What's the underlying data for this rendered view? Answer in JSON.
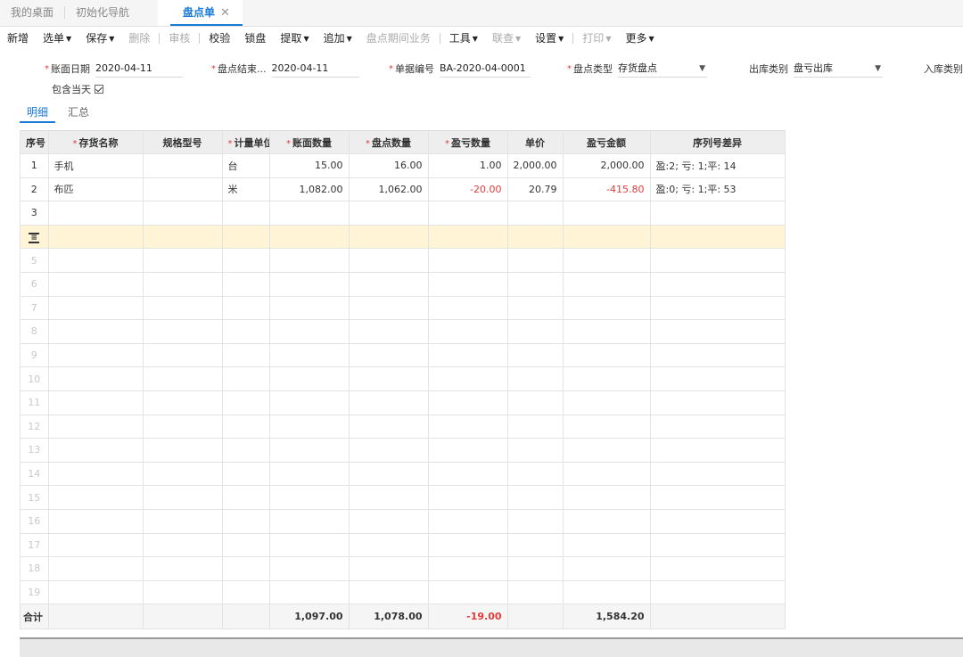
{
  "tabs": [
    {
      "label": "我的桌面",
      "active": false
    },
    {
      "label": "初始化导航",
      "active": false
    },
    {
      "label": "盘点单",
      "active": true
    }
  ],
  "tab_close": "✕",
  "toolbar": {
    "new": "新增",
    "select": "选单",
    "save": "保存",
    "delete": "删除",
    "audit": "审核",
    "verify": "校验",
    "lock": "锁盘",
    "extract": "提取",
    "append": "追加",
    "period_business": "盘点期间业务",
    "tools": "工具",
    "query": "联查",
    "settings": "设置",
    "print": "打印",
    "more": "更多"
  },
  "form": {
    "book_date": {
      "label": "账面日期",
      "value": "2020-04-11"
    },
    "end_date": {
      "label": "盘点结束...",
      "value": "2020-04-11"
    },
    "doc_no": {
      "label": "单据编号",
      "value": "BA-2020-04-0001"
    },
    "count_type": {
      "label": "盘点类型",
      "value": "存货盘点"
    },
    "out_type": {
      "label": "出库类别",
      "value": "盘亏出库"
    },
    "in_type": {
      "label": "入库类别"
    },
    "include_today": {
      "label": "包含当天",
      "checked": true
    }
  },
  "subtabs": [
    {
      "label": "明细",
      "active": true
    },
    {
      "label": "汇总",
      "active": false
    }
  ],
  "columns": [
    "序号",
    "存货名称",
    "规格型号",
    "计量单位",
    "账面数量",
    "盘点数量",
    "盈亏数量",
    "单价",
    "盈亏金额",
    "序列号差异"
  ],
  "required_columns": [
    1,
    3,
    4,
    5,
    6
  ],
  "rows": [
    {
      "idx": "1",
      "name": "手机",
      "spec": "",
      "unit": "台",
      "book_qty": "15.00",
      "count_qty": "16.00",
      "diff_qty": "1.00",
      "price": "2,000.00",
      "diff_amount": "2,000.00",
      "serial_diff": "盈:2; 亏: 1;平: 14",
      "negative": false
    },
    {
      "idx": "2",
      "name": "布匹",
      "spec": "",
      "unit": "米",
      "book_qty": "1,082.00",
      "count_qty": "1,062.00",
      "diff_qty": "-20.00",
      "price": "20.79",
      "diff_amount": "-415.80",
      "serial_diff": "盈:0; 亏: 1;平: 53",
      "negative": true
    },
    {
      "idx": "3"
    }
  ],
  "empty_rows": [
    "5",
    "6",
    "7",
    "8",
    "9",
    "10",
    "11",
    "12",
    "13",
    "14",
    "15",
    "16",
    "17",
    "18",
    "19"
  ],
  "totals": {
    "label": "合计",
    "book_qty": "1,097.00",
    "count_qty": "1,078.00",
    "diff_qty": "-19.00",
    "diff_amount": "1,584.20"
  },
  "colors": {
    "accent": "#1a7ad8",
    "negative": "#e03c3c",
    "active_row": "#fff5d6"
  }
}
